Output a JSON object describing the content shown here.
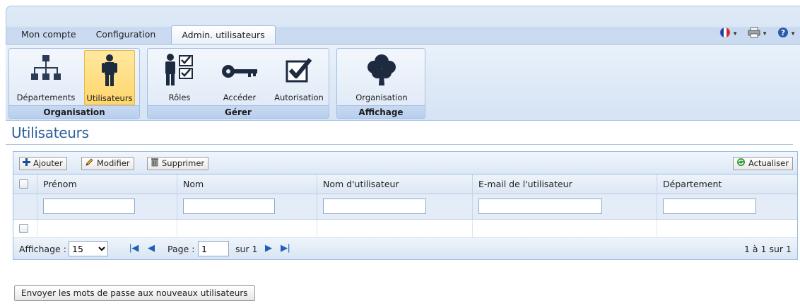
{
  "tabs": [
    {
      "label": "Mon compte"
    },
    {
      "label": "Configuration"
    },
    {
      "label": "Admin. utilisateurs"
    }
  ],
  "ribbon": {
    "groups": [
      {
        "title": "Organisation",
        "buttons": [
          {
            "label": "Départements"
          },
          {
            "label": "Utilisateurs",
            "active": true
          }
        ]
      },
      {
        "title": "Gérer",
        "buttons": [
          {
            "label": "Rôles"
          },
          {
            "label": "Accéder"
          },
          {
            "label": "Autorisation"
          }
        ]
      },
      {
        "title": "Affichage",
        "buttons": [
          {
            "label": "Organisation"
          }
        ]
      }
    ]
  },
  "topright": {
    "icons": [
      "flag-fr-icon",
      "printer-icon",
      "help-icon"
    ]
  },
  "page": {
    "title": "Utilisateurs"
  },
  "toolbar": {
    "add_label": "Ajouter",
    "edit_label": "Modifier",
    "delete_label": "Supprimer",
    "refresh_label": "Actualiser"
  },
  "grid": {
    "columns": [
      "Prénom",
      "Nom",
      "Nom d'utilisateur",
      "E-mail de l'utilisateur",
      "Département"
    ],
    "filters": [
      "",
      "",
      "",
      "",
      ""
    ]
  },
  "pager": {
    "display_label": "Affichage :",
    "page_size": "15",
    "page_label": "Page :",
    "page_value": "1",
    "of_label": "sur 1",
    "summary": "1 à 1 sur 1"
  },
  "actions": {
    "send_passwords_label": "Envoyer les mots de passe aux nouveaux utilisateurs"
  },
  "colors": {
    "accent": "#2f5f9a",
    "ribbon_bg": "#d5e3f4",
    "active_button": "#ffd66b"
  }
}
